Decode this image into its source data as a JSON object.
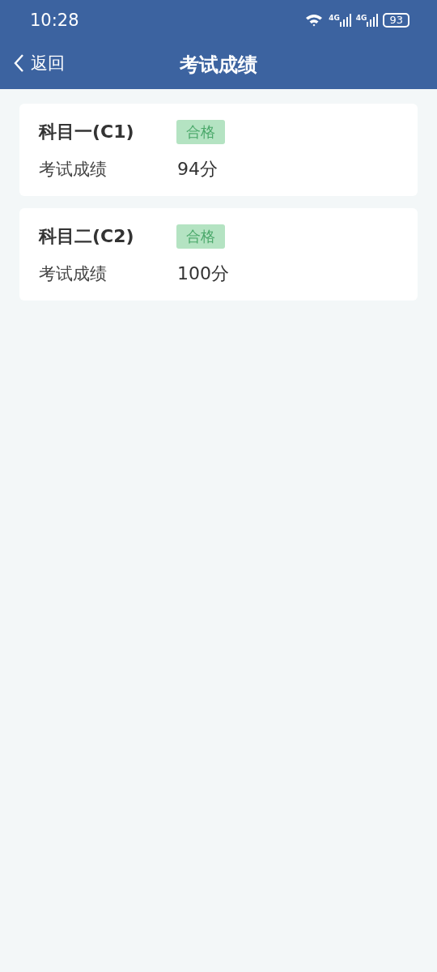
{
  "status_bar": {
    "time": "10:28",
    "network_labels": [
      "4G",
      "4G"
    ],
    "battery": "93"
  },
  "nav": {
    "back": "返回",
    "title": "考试成绩"
  },
  "results": [
    {
      "subject": "科目一(C1)",
      "badge": "合格",
      "label": "考试成绩",
      "score": "94分"
    },
    {
      "subject": "科目二(C2)",
      "badge": "合格",
      "label": "考试成绩",
      "score": "100分"
    }
  ]
}
